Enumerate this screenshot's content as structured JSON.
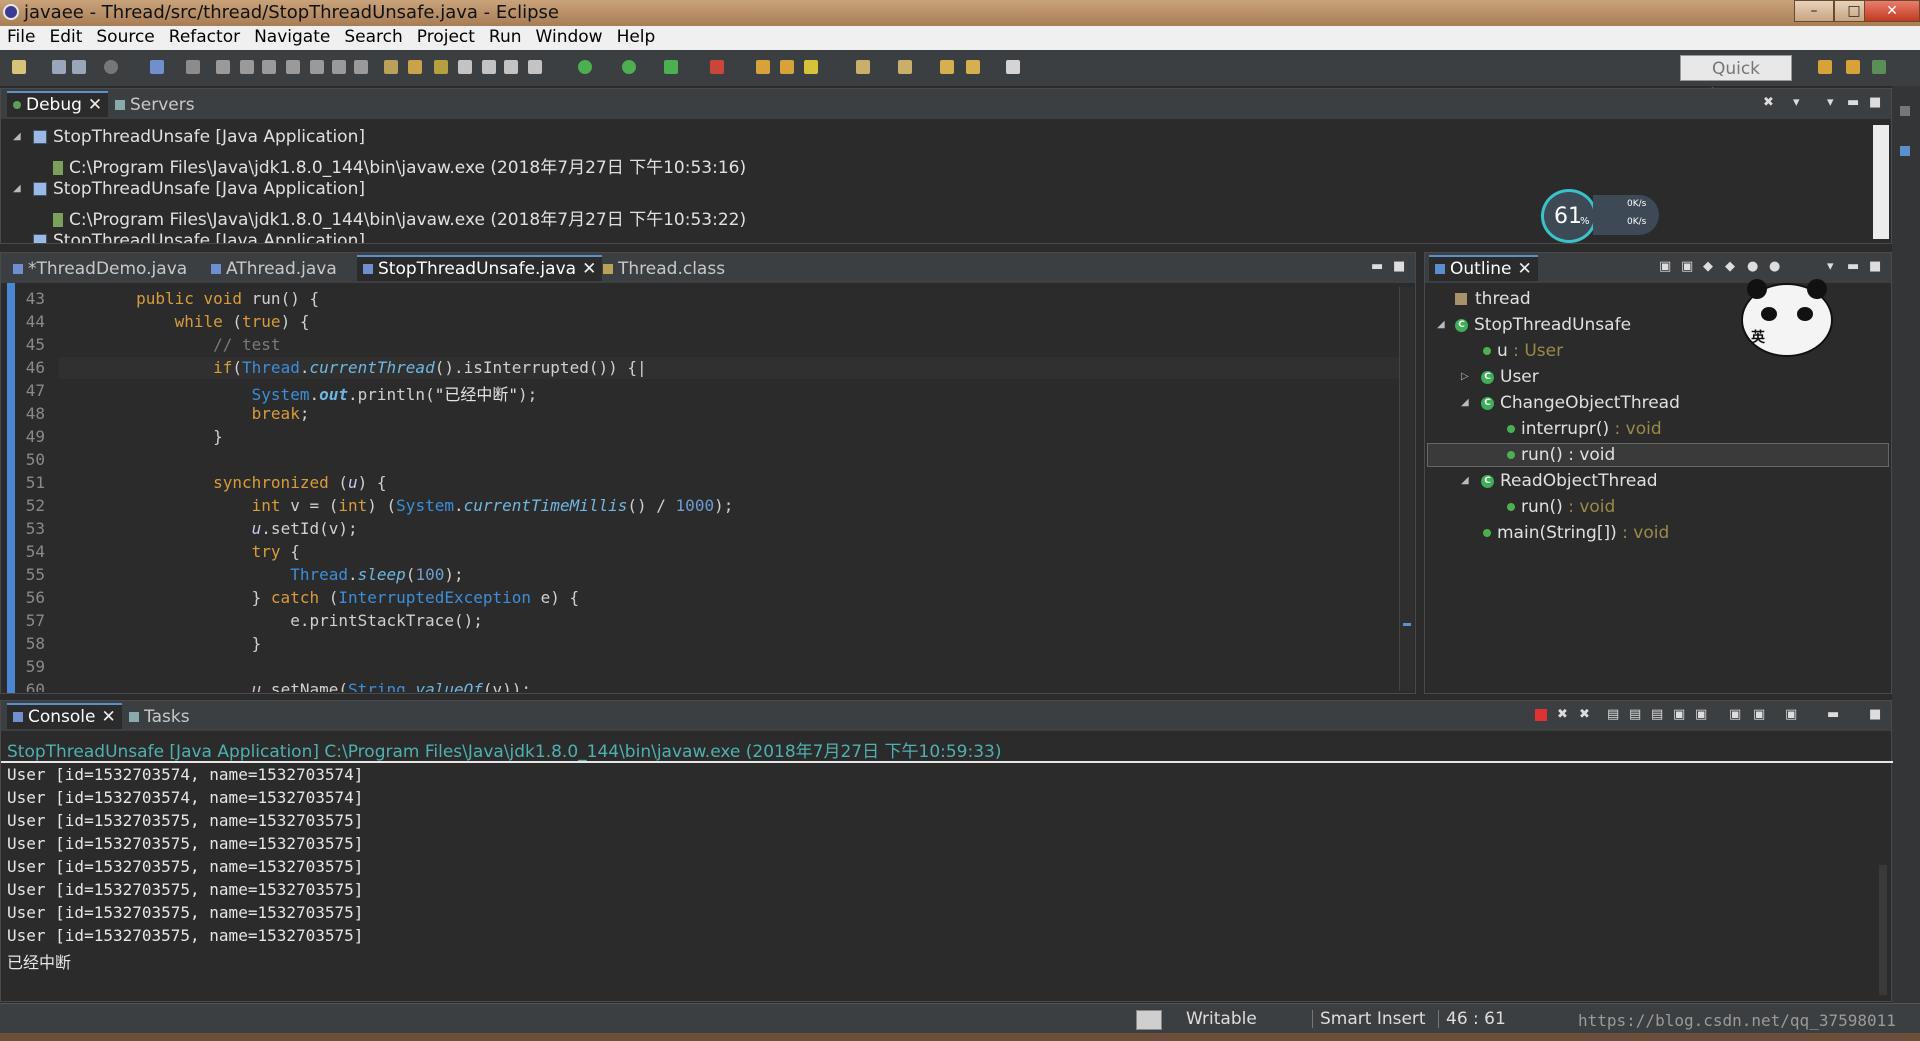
{
  "window": {
    "title": "javaee - Thread/src/thread/StopThreadUnsafe.java - Eclipse",
    "min": "–",
    "max": "□",
    "close": "✕"
  },
  "menu": [
    "File",
    "Edit",
    "Source",
    "Refactor",
    "Navigate",
    "Search",
    "Project",
    "Run",
    "Window",
    "Help"
  ],
  "toolbar": {
    "quick_access": "Quick Access"
  },
  "debug": {
    "tabs": {
      "debug": "Debug",
      "servers": "Servers"
    },
    "lines": [
      {
        "text": "StopThreadUnsafe [Java Application]"
      },
      {
        "text": "C:\\Program Files\\Java\\jdk1.8.0_144\\bin\\javaw.exe (2018年7月27日 下午10:53:16)"
      },
      {
        "text": "StopThreadUnsafe [Java Application]"
      },
      {
        "text": "C:\\Program Files\\Java\\jdk1.8.0_144\\bin\\javaw.exe (2018年7月27日 下午10:53:22)"
      },
      {
        "text": "StopThreadUnsafe [Java Application]"
      }
    ],
    "gauge": {
      "percent": "61",
      "unit": "%",
      "up": "0K/s",
      "down": "0K/s"
    }
  },
  "editor": {
    "tabs": [
      "*ThreadDemo.java",
      "AThread.java",
      "StopThreadUnsafe.java",
      "Thread.class"
    ],
    "line_numbers": [
      "43",
      "44",
      "45",
      "46",
      "47",
      "48",
      "49",
      "50",
      "51",
      "52",
      "53",
      "54",
      "55",
      "56",
      "57",
      "58",
      "59",
      "60"
    ]
  },
  "outline": {
    "tab": "Outline",
    "items": [
      {
        "name": "thread",
        "type": ""
      },
      {
        "name": "StopThreadUnsafe",
        "type": ""
      },
      {
        "name": "u",
        "type": " : User"
      },
      {
        "name": "User",
        "type": ""
      },
      {
        "name": "ChangeObjectThread",
        "type": ""
      },
      {
        "name": "interrupr()",
        "type": " : void"
      },
      {
        "name": "run() : void",
        "type": ""
      },
      {
        "name": "ReadObjectThread",
        "type": ""
      },
      {
        "name": "run()",
        "type": " : void"
      },
      {
        "name": "main(String[])",
        "type": " : void"
      }
    ],
    "mascot": "英"
  },
  "console": {
    "tabs": {
      "console": "Console",
      "tasks": "Tasks"
    },
    "header": "StopThreadUnsafe [Java Application] C:\\Program Files\\Java\\jdk1.8.0_144\\bin\\javaw.exe (2018年7月27日 下午10:59:33)",
    "lines": [
      "User [id=1532703574, name=1532703574]",
      "User [id=1532703574, name=1532703574]",
      "User [id=1532703575, name=1532703575]",
      "User [id=1532703575, name=1532703575]",
      "User [id=1532703575, name=1532703575]",
      "User [id=1532703575, name=1532703575]",
      "User [id=1532703575, name=1532703575]",
      "User [id=1532703575, name=1532703575]",
      "已经中断"
    ]
  },
  "status": {
    "writable": "Writable",
    "insert": "Smart Insert",
    "position": "46 : 61",
    "watermark": "https://blog.csdn.net/qq_37598011"
  }
}
